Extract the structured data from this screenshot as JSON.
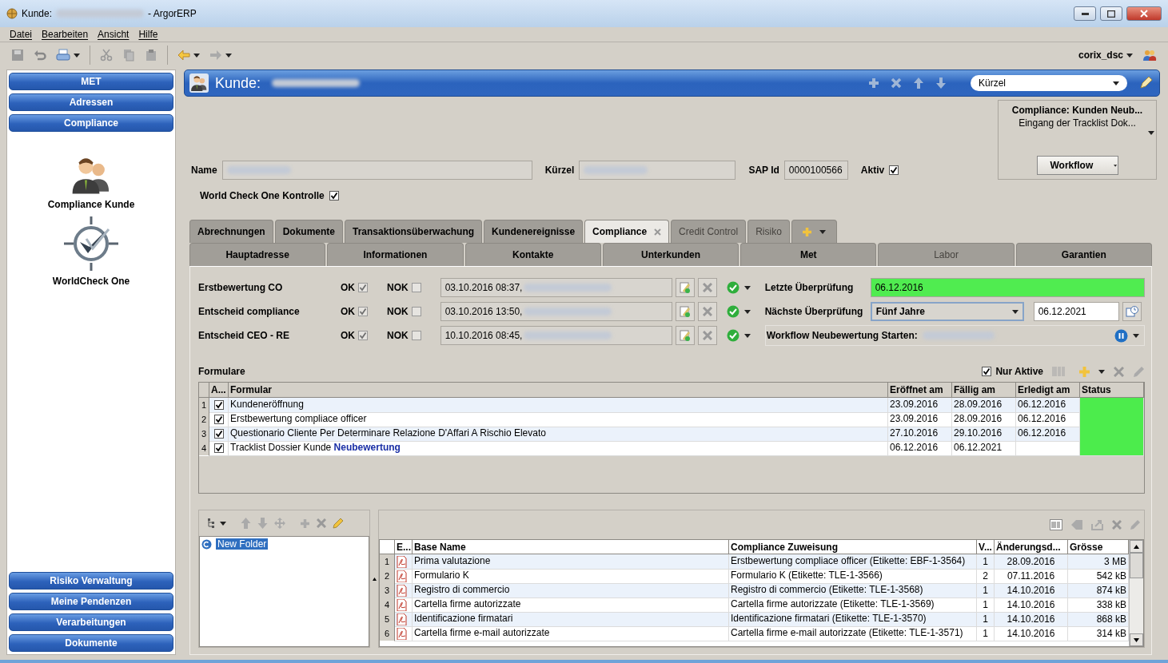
{
  "window": {
    "title_prefix": "Kunde:",
    "title_suffix": "- ArgorERP"
  },
  "menu": [
    "Datei",
    "Bearbeiten",
    "Ansicht",
    "Hilfe"
  ],
  "user": "corix_dsc",
  "sidebar": {
    "top_buttons": [
      "MET",
      "Adressen",
      "Compliance"
    ],
    "shortcuts": [
      {
        "label": "Compliance Kunde",
        "kind": "people"
      },
      {
        "label": "WorldCheck One",
        "kind": "check"
      }
    ],
    "bottom_buttons": [
      "Risiko Verwaltung",
      "Meine Pendenzen",
      "Verarbeitungen",
      "Dokumente"
    ]
  },
  "header": {
    "title": "Kunde:",
    "search_mode": "Kürzel"
  },
  "customer": {
    "name_label": "Name",
    "short_label": "Kürzel",
    "sap_label": "SAP Id",
    "sap_id": "0000100566",
    "active_label": "Aktiv",
    "active": true,
    "wco_label": "World Check One Kontrolle",
    "wco": true
  },
  "workflow_box": {
    "title": "Compliance: Kunden Neub...",
    "subtitle": "Eingang der Tracklist Dok...",
    "button": "Workflow"
  },
  "tabs_row1": [
    {
      "label": "Abrechnungen",
      "selected": false,
      "disabled": false
    },
    {
      "label": "Dokumente",
      "selected": false,
      "disabled": false
    },
    {
      "label": "Transaktionsüberwachung",
      "selected": false,
      "disabled": false
    },
    {
      "label": "Kundenereignisse",
      "selected": false,
      "disabled": false
    },
    {
      "label": "Compliance",
      "selected": true,
      "disabled": false
    },
    {
      "label": "Credit Control",
      "selected": false,
      "disabled": true
    },
    {
      "label": "Risiko",
      "selected": false,
      "disabled": true
    }
  ],
  "tabs_row2": [
    {
      "label": "Hauptadresse",
      "disabled": false
    },
    {
      "label": "Informationen",
      "disabled": false
    },
    {
      "label": "Kontakte",
      "disabled": false
    },
    {
      "label": "Unterkunden",
      "disabled": false
    },
    {
      "label": "Met",
      "disabled": false
    },
    {
      "label": "Labor",
      "disabled": true
    },
    {
      "label": "Garantien",
      "disabled": false
    }
  ],
  "approvals": {
    "rows": [
      {
        "label": "Erstbewertung CO",
        "ok_label": "OK",
        "ok": true,
        "nok_label": "NOK",
        "nok": false,
        "timestamp": "03.10.2016 08:37,"
      },
      {
        "label": "Entscheid compliance",
        "ok_label": "OK",
        "ok": true,
        "nok_label": "NOK",
        "nok": false,
        "timestamp": "03.10.2016 13:50,"
      },
      {
        "label": "Entscheid CEO - RE",
        "ok_label": "OK",
        "ok": true,
        "nok_label": "NOK",
        "nok": false,
        "timestamp": "10.10.2016 08:45,"
      }
    ]
  },
  "review": {
    "last_label": "Letzte Überprüfung",
    "last": "06.12.2016",
    "next_label": "Nächste Überprüfung",
    "interval": "Fünf Jahre",
    "next": "06.12.2021",
    "workflow_label": "Workflow Neubewertung Starten:"
  },
  "formulare": {
    "title": "Formulare",
    "only_active_label": "Nur Aktive",
    "only_active": true,
    "columns": [
      "A...",
      "Formular",
      "Eröffnet am",
      "Fällig am",
      "Erledigt am",
      "Status"
    ],
    "rows": [
      {
        "n": "1",
        "active": true,
        "form": "Kundeneröffnung",
        "opened": "23.09.2016",
        "due": "28.09.2016",
        "done": "06.12.2016",
        "color": "#4cec4c"
      },
      {
        "n": "2",
        "active": true,
        "form": "Erstbewertung compliace officer",
        "opened": "23.09.2016",
        "due": "28.09.2016",
        "done": "06.12.2016",
        "color": "#4cec4c"
      },
      {
        "n": "3",
        "active": true,
        "form": "Questionario Cliente Per Determinare Relazione D'Affari A Rischio Elevato",
        "opened": "27.10.2016",
        "due": "29.10.2016",
        "done": "06.12.2016",
        "color": "#4cec4c"
      },
      {
        "n": "4",
        "active": true,
        "form": "Tracklist Dossier Kunde **Neubewertung**",
        "opened": "06.12.2016",
        "due": "06.12.2021",
        "done": "",
        "color": "#4cec4c"
      }
    ]
  },
  "documents": {
    "folder": "New Folder",
    "columns": [
      "E...",
      "Base Name",
      "Compliance Zuweisung",
      "V...",
      "Änderungsd...",
      "Grösse"
    ],
    "rows": [
      {
        "n": "1",
        "name": "Prima valutazione",
        "assignment": "Erstbewertung compliace officer (Etikette: EBF-1-3564)",
        "version": "1",
        "date": "28.09.2016",
        "size": "3 MB"
      },
      {
        "n": "2",
        "name": "Formulario K",
        "assignment": "Formulario K (Etikette: TLE-1-3566)",
        "version": "2",
        "date": "07.11.2016",
        "size": "542 kB"
      },
      {
        "n": "3",
        "name": "Registro di commercio",
        "assignment": "Registro di commercio (Etikette: TLE-1-3568)",
        "version": "1",
        "date": "14.10.2016",
        "size": "874 kB"
      },
      {
        "n": "4",
        "name": "Cartella firme autorizzate",
        "assignment": "Cartella firme autorizzate (Etikette: TLE-1-3569)",
        "version": "1",
        "date": "14.10.2016",
        "size": "338 kB"
      },
      {
        "n": "5",
        "name": "Identificazione firmatari",
        "assignment": "Identificazione firmatari (Etikette: TLE-1-3570)",
        "version": "1",
        "date": "14.10.2016",
        "size": "868 kB"
      },
      {
        "n": "6",
        "name": "Cartella firme e-mail autorizzate",
        "assignment": "Cartella firme e-mail autorizzate (Etikette: TLE-1-3571)",
        "version": "1",
        "date": "14.10.2016",
        "size": "314 kB"
      }
    ]
  }
}
